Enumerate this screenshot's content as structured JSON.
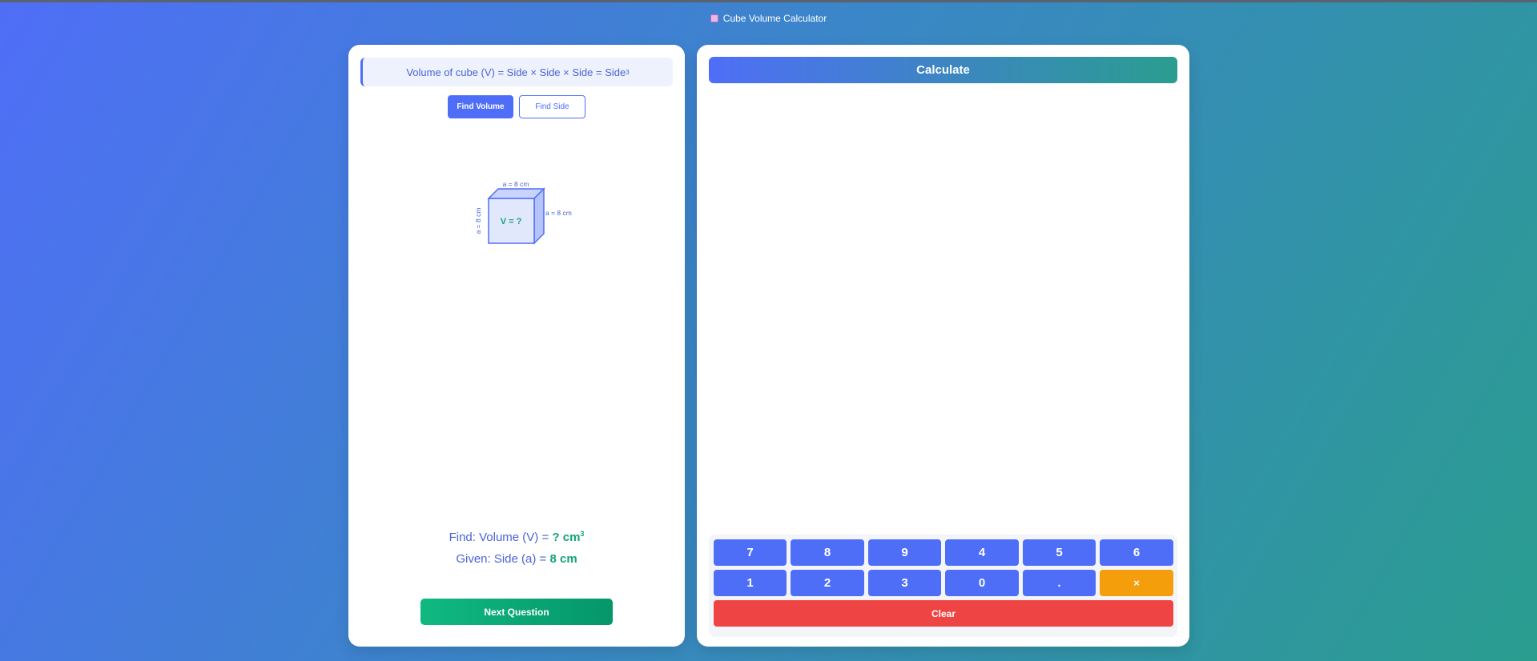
{
  "app": {
    "title": "Cube Volume Calculator"
  },
  "left": {
    "formula": {
      "text": "Volume of cube (V) = Side × Side × Side = Side",
      "exponent": "3"
    },
    "tabs": [
      {
        "label": "Find Volume",
        "active": true
      },
      {
        "label": "Find Side",
        "active": false
      }
    ],
    "diagram": {
      "top_label": "a = 8 cm",
      "right_label": "a = 8 cm",
      "left_label": "a = 8 cm",
      "center_label": "V = ?"
    },
    "find": {
      "prefix": "Find: Volume (V) = ",
      "value": "? cm",
      "exponent": "3"
    },
    "given": {
      "prefix": "Given: Side (a) = ",
      "value": "8 cm"
    },
    "next_label": "Next Question"
  },
  "right": {
    "calculate_label": "Calculate",
    "keypad": {
      "row1": [
        "7",
        "8",
        "9",
        "4",
        "5",
        "6"
      ],
      "row2": [
        "1",
        "2",
        "3",
        "0",
        "."
      ],
      "backspace": "×",
      "clear": "Clear"
    }
  },
  "colors": {
    "primary": "#4f6ef7",
    "accent_green": "#10b981",
    "backspace": "#f59e0b",
    "clear": "#ef4444"
  }
}
